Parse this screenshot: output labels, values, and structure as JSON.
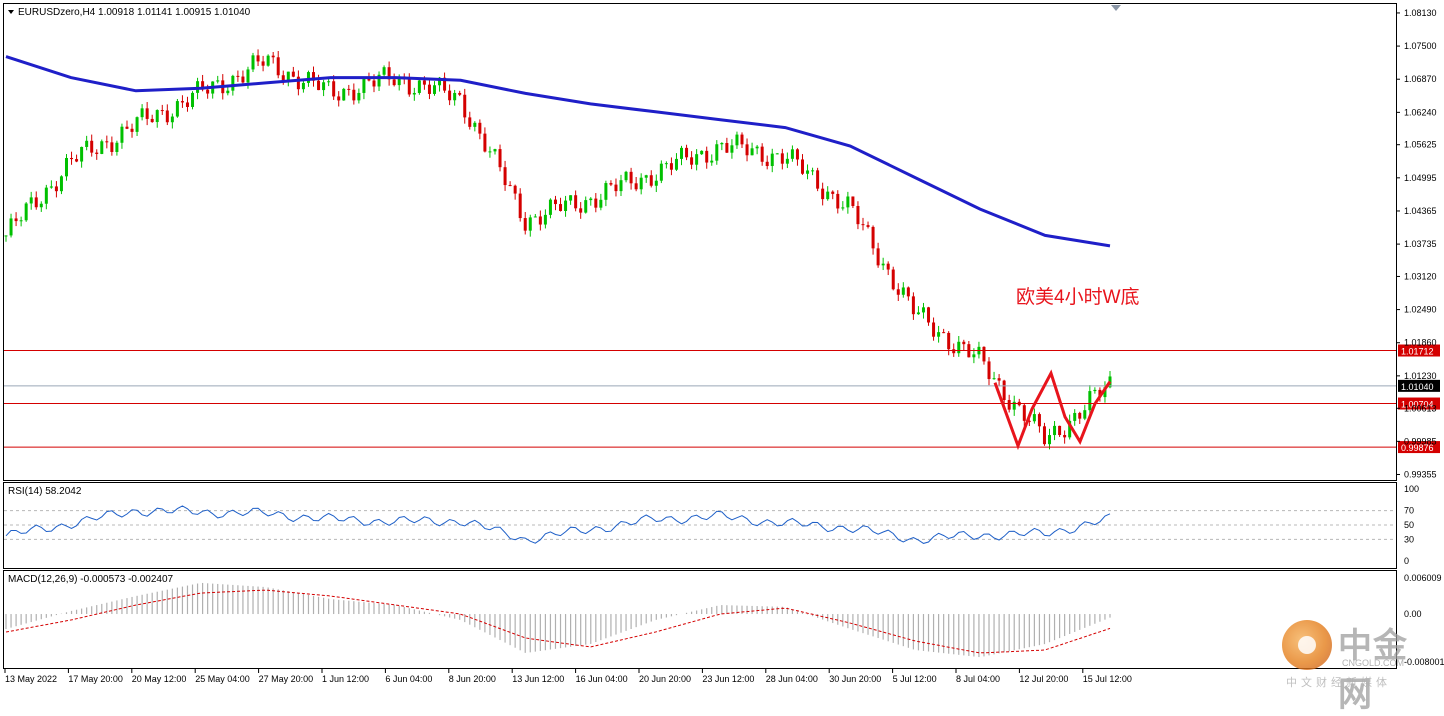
{
  "window": {
    "symbol_header": "EURUSDzero,H4  1.00918 1.01141 1.00915 1.01040"
  },
  "colors": {
    "bull": "#00c000",
    "bear": "#d40000",
    "ma": "#1f1fc8",
    "support_lines": "#d40000",
    "price_line": "#9aa8b8",
    "rsi": "#1f60c8",
    "macd_signal": "#d40000",
    "macd_hist": "#b0b0b0",
    "annotation": "#e8141c"
  },
  "main_chart": {
    "annotation": "欧美4小时W底",
    "price_axis_labels": [
      "1.08130",
      "1.07500",
      "1.06870",
      "1.06240",
      "1.05625",
      "1.04995",
      "1.04365",
      "1.03735",
      "1.03120",
      "1.02490",
      "1.01860",
      "1.01230",
      "1.00613",
      "0.99985",
      "0.99355"
    ],
    "horizontal_levels": [
      {
        "value": 1.01712,
        "label": "1.01712",
        "style": "red-box"
      },
      {
        "value": 1.00704,
        "label": "1.00704",
        "style": "red-box"
      },
      {
        "value": 0.99876,
        "label": "0.99876",
        "style": "red-box"
      },
      {
        "value": 1.0104,
        "label": "1.01040",
        "style": "current-price"
      }
    ]
  },
  "rsi_panel": {
    "title": "RSI(14) 58.2042",
    "axis_labels": [
      "100",
      "70",
      "50",
      "30",
      "0"
    ]
  },
  "macd_panel": {
    "title": "MACD(12,26,9) -0.000573 -0.002407",
    "axis_labels": [
      "0.006009",
      "0.00",
      "-0.008001"
    ]
  },
  "time_axis_labels": [
    "13 May 2022",
    "17 May 20:00",
    "20 May 12:00",
    "25 May 04:00",
    "27 May 20:00",
    "1 Jun 12:00",
    "6 Jun 04:00",
    "8 Jun 20:00",
    "13 Jun 12:00",
    "16 Jun 04:00",
    "20 Jun 20:00",
    "23 Jun 12:00",
    "28 Jun 04:00",
    "30 Jun 20:00",
    "5 Jul 12:00",
    "8 Jul 04:00",
    "12 Jul 20:00",
    "15 Jul 12:00"
  ],
  "watermark": {
    "name": "中金网",
    "domain": "CNGOLD.COM",
    "tagline": "中文财经新媒体"
  },
  "chart_data": {
    "type": "line",
    "title": "EURUSDzero,H4",
    "x": [
      "13 May 2022",
      "17 May 20:00",
      "20 May 12:00",
      "25 May 04:00",
      "27 May 20:00",
      "1 Jun 12:00",
      "6 Jun 04:00",
      "8 Jun 20:00",
      "13 Jun 12:00",
      "16 Jun 04:00",
      "20 Jun 20:00",
      "23 Jun 12:00",
      "28 Jun 04:00",
      "30 Jun 20:00",
      "5 Jul 12:00",
      "8 Jul 04:00",
      "12 Jul 20:00",
      "15 Jul 12:00"
    ],
    "ylim": [
      0.9925,
      1.083
    ],
    "series": [
      {
        "name": "EURUSDzero,H4",
        "values": [
          1.039,
          1.053,
          1.06,
          1.066,
          1.072,
          1.066,
          1.069,
          1.065,
          1.042,
          1.046,
          1.051,
          1.056,
          1.054,
          1.044,
          1.024,
          1.015,
          1.0,
          1.0104
        ]
      },
      {
        "values": [
          1.073,
          1.069,
          1.0665,
          1.067,
          1.068,
          1.069,
          1.069,
          1.0685,
          1.066,
          1.064,
          1.0625,
          1.061,
          1.0595,
          1.056,
          1.05,
          1.044,
          1.039,
          1.037
        ]
      }
    ],
    "rsi": {
      "title": "RSI(14) 58.2042",
      "ylim": [
        0,
        100
      ],
      "levels": [
        70,
        50,
        30
      ],
      "values": [
        35,
        52,
        70,
        68,
        66,
        58,
        55,
        56,
        30,
        44,
        58,
        62,
        52,
        46,
        30,
        36,
        38,
        58
      ]
    },
    "macd": {
      "title": "MACD(12,26,9) -0.000573 -0.002407",
      "ylim": [
        -0.008001,
        0.006009
      ],
      "histogram": [
        -0.0025,
        0.0005,
        0.003,
        0.0052,
        0.0045,
        0.0025,
        0.0015,
        -0.001,
        -0.0065,
        -0.005,
        -0.001,
        0.0015,
        0.0012,
        -0.0025,
        -0.006,
        -0.0072,
        -0.005,
        -0.0006
      ],
      "signal": [
        -0.003,
        -0.001,
        0.0015,
        0.0035,
        0.004,
        0.003,
        0.0015,
        0.0,
        -0.004,
        -0.0055,
        -0.003,
        0.0,
        0.001,
        -0.0015,
        -0.0045,
        -0.0065,
        -0.006,
        -0.0024
      ]
    }
  }
}
